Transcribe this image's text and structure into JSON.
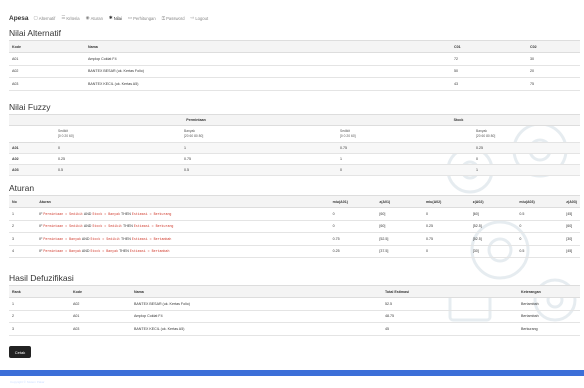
{
  "nav": {
    "brand": "Apesa",
    "items": [
      {
        "icon": "▢",
        "label": "Alternatif"
      },
      {
        "icon": "☰",
        "label": "Kriteria"
      },
      {
        "icon": "◉",
        "label": "Aturan"
      },
      {
        "icon": "✱",
        "label": "Nilai"
      },
      {
        "icon": "▭",
        "label": "Perhitungan"
      },
      {
        "icon": "⚿",
        "label": "Password"
      },
      {
        "icon": "⇨",
        "label": "Logout"
      }
    ]
  },
  "alternatif": {
    "title": "Nilai Alternatif",
    "headers": [
      "Kode",
      "Nama",
      "C01",
      "C02"
    ],
    "rows": [
      [
        "A01",
        "Amplop Coklat F4",
        "72",
        "30"
      ],
      [
        "A02",
        "BANTEX BESAR (uk. Kertas Folio)",
        "50",
        "20"
      ],
      [
        "A03",
        "BANTEX KECIL (uk. Kertas A5)",
        "43",
        "75"
      ]
    ]
  },
  "fuzzy": {
    "title": "Nilai Fuzzy",
    "group_permintaan": "Permintaan",
    "group_stock": "Stock",
    "sub": [
      {
        "name": "Sedikit",
        "range": "[0 0 20 60]"
      },
      {
        "name": "Banyak",
        "range": "[20 60 80 80]"
      },
      {
        "name": "Sedikit",
        "range": "[0 0 20 60]"
      },
      {
        "name": "Banyak",
        "range": "[20 60 80 80]"
      }
    ],
    "rows": [
      [
        "A01",
        "0",
        "1",
        "0.75",
        "0.25"
      ],
      [
        "A02",
        "0.25",
        "0.75",
        "1",
        "0"
      ],
      [
        "A03",
        "0.5",
        "0.5",
        "0",
        "1"
      ]
    ]
  },
  "aturan": {
    "title": "Aturan",
    "headers": [
      "No",
      "Aturan",
      "miu(A01)",
      "z(A01)",
      "miu(A02)",
      "z(A02)",
      "miu(A03)",
      "z(A03)"
    ],
    "rows": [
      {
        "no": "1",
        "if": "IF",
        "c1": "Permintaan = Sedikit",
        "and": "AND",
        "c2": "Stock = Banyak",
        "then": "THEN",
        "res": "Estimasi = Berkurang",
        "v": [
          "0",
          "[60]",
          "0",
          "[60]",
          "0.5",
          "[45]"
        ]
      },
      {
        "no": "2",
        "if": "IF",
        "c1": "Permintaan = Sedikit",
        "and": "AND",
        "c2": "Stock = Sedikit",
        "then": "THEN",
        "res": "Estimasi = Berkurang",
        "v": [
          "0",
          "[60]",
          "0.25",
          "[52.5]",
          "0",
          "[60]"
        ]
      },
      {
        "no": "3",
        "if": "IF",
        "c1": "Permintaan = Banyak",
        "and": "AND",
        "c2": "Stock = Sedikit",
        "then": "THEN",
        "res": "Estimasi = Bertambah",
        "v": [
          "0.75",
          "[52.5]",
          "0.75",
          "[52.5]",
          "0",
          "[30]"
        ]
      },
      {
        "no": "4",
        "if": "IF",
        "c1": "Permintaan = Banyak",
        "and": "AND",
        "c2": "Stock = Banyak",
        "then": "THEN",
        "res": "Estimasi = Bertambah",
        "v": [
          "0.25",
          "[37.5]",
          "0",
          "[30]",
          "0.5",
          "[45]"
        ]
      }
    ]
  },
  "hasil": {
    "title": "Hasil Defuzifikasi",
    "headers": [
      "Rank",
      "Kode",
      "Nama",
      "Total Estimasi",
      "Keterangan"
    ],
    "rows": [
      [
        "1",
        "A02",
        "BANTEX BESAR (uk. Kertas Folio)",
        "52.5",
        "Bertambah"
      ],
      [
        "2",
        "A01",
        "Amplop Coklat F4",
        "48.75",
        "Bertambah"
      ],
      [
        "3",
        "A03",
        "BANTEX KECIL (uk. Kertas A5)",
        "45",
        "Berkurang"
      ]
    ]
  },
  "cetak_label": "Cetak",
  "footer_text": "Copyright © Sistem Pakar"
}
